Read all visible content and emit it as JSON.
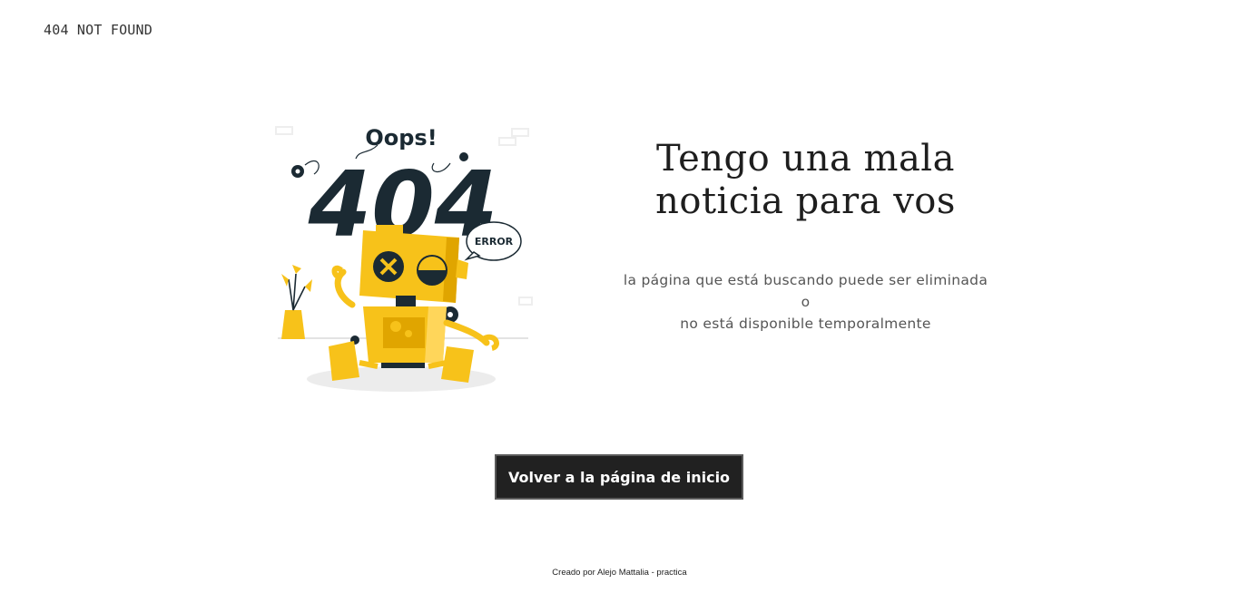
{
  "header": {
    "title": "404 NOT FOUND"
  },
  "illustration": {
    "oops_text": "Oops!",
    "code_text": "404",
    "error_text": "ERROR",
    "icon": "robot-404-illustration",
    "colors": {
      "robot": "#f7c21a",
      "dark": "#1b2a33"
    }
  },
  "main": {
    "headline_line1": "Tengo una mala",
    "headline_line2": "noticia para vos",
    "subtext_line1": "la página que está buscando puede ser eliminada o",
    "subtext_line2": "no está disponible temporalmente",
    "button_label": "Volver a la página de inicio"
  },
  "footer": {
    "text": "Creado por Alejo Mattalia - practica"
  }
}
